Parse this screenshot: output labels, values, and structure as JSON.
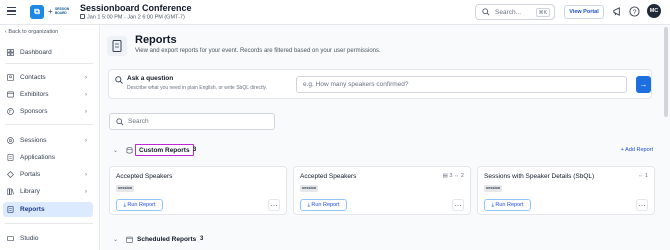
{
  "app": {
    "event_title": "Sessionboard Conference",
    "event_dates": "Jan 1 5:00 PM - Jan 2 6:00 PM (GMT-7)",
    "brand_logo_text": "SESSION BOARD",
    "search_placeholder": "Search...",
    "search_shortcut": "⌘K",
    "view_portal_label": "View Portal",
    "avatar_initials": "MC",
    "accent_color": "#1d6fe0"
  },
  "sidebar": {
    "back_label": "Back to organization",
    "items": [
      {
        "label": "Dashboard",
        "icon": "grid-icon",
        "chevron": false
      },
      {
        "label": "Contacts",
        "icon": "contacts-icon",
        "chevron": true
      },
      {
        "label": "Exhibitors",
        "icon": "exhibitors-icon",
        "chevron": true
      },
      {
        "label": "Sponsors",
        "icon": "sponsors-icon",
        "chevron": true
      },
      {
        "label": "Sessions",
        "icon": "sessions-icon",
        "chevron": true
      },
      {
        "label": "Applications",
        "icon": "applications-icon",
        "chevron": false
      },
      {
        "label": "Portals",
        "icon": "portals-icon",
        "chevron": true
      },
      {
        "label": "Library",
        "icon": "library-icon",
        "chevron": true
      },
      {
        "label": "Reports",
        "icon": "reports-icon",
        "chevron": false,
        "active": true
      },
      {
        "label": "Studio",
        "icon": "studio-icon",
        "chevron": false
      }
    ]
  },
  "main": {
    "title": "Reports",
    "subtitle": "View and export reports for your event. Records are filtered based on your user permissions.",
    "ask": {
      "title": "Ask a question",
      "description": "Describe what you need in plain English, or write SbQL directly.",
      "placeholder": "e.g. How many speakers confirmed?",
      "send_icon": "arrow-right-icon"
    },
    "search_placeholder": "Search",
    "custom_reports": {
      "label": "Custom Reports",
      "count": "3",
      "add_label": "+ Add Report"
    },
    "cards": [
      {
        "title": "Accepted Speakers",
        "tag": "session",
        "meta": "",
        "run_label": "Run Report"
      },
      {
        "title": "Accepted Speakers",
        "tag": "session",
        "meta": "▤ 3   ⇔ 2",
        "run_label": "Run Report"
      },
      {
        "title": "Sessions with Speaker Details (SbQL)",
        "tag": "session",
        "meta": "⇔ 1",
        "run_label": "Run Report"
      }
    ],
    "scheduled_reports": {
      "label": "Scheduled Reports",
      "count": "3"
    }
  }
}
